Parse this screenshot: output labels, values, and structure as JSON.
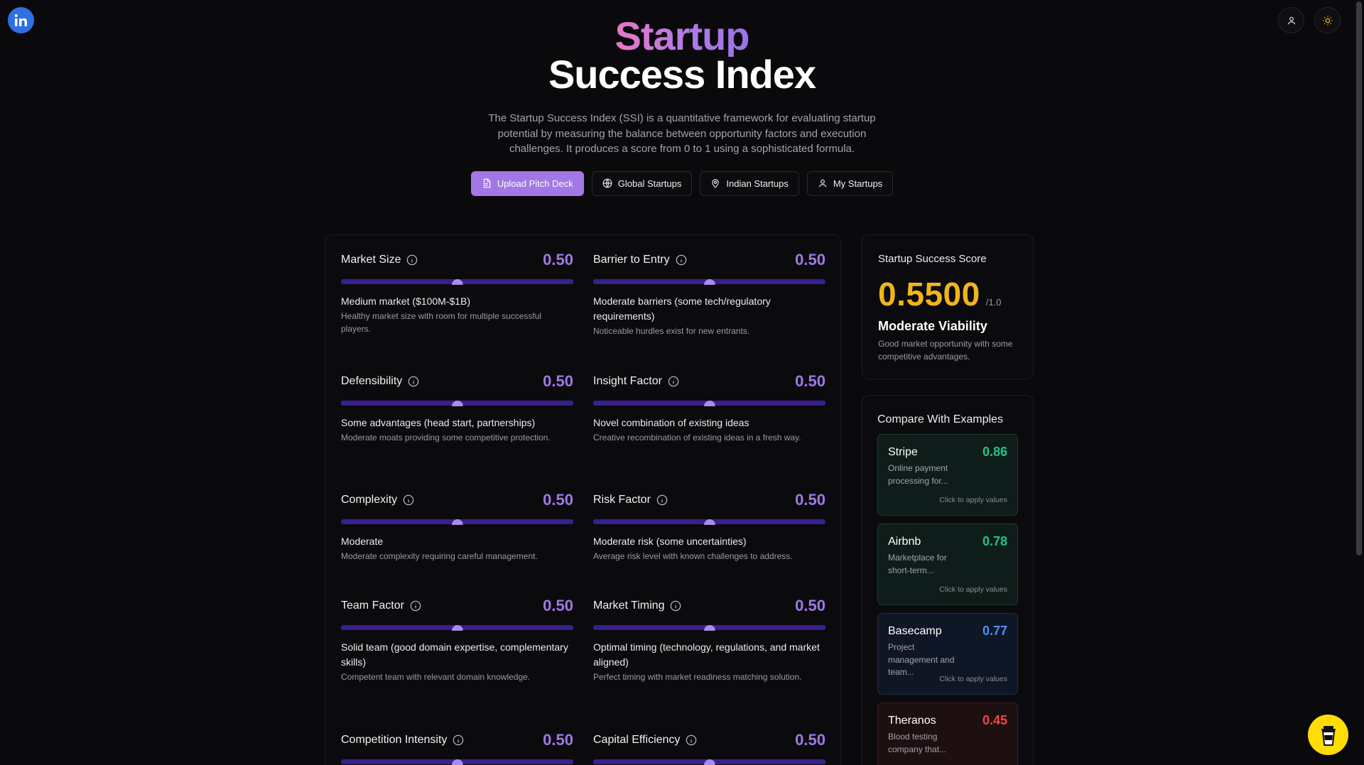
{
  "hero": {
    "title_line1": "Startup",
    "title_line2": "Success Index",
    "description": "The Startup Success Index (SSI) is a quantitative framework for evaluating startup potential by measuring the balance between opportunity factors and execution challenges. It produces a score from 0 to 1 using a sophisticated formula."
  },
  "actions": {
    "upload": "Upload Pitch Deck",
    "global": "Global Startups",
    "indian": "Indian Startups",
    "mine": "My Startups"
  },
  "factors": [
    {
      "name": "Market Size",
      "value": "0.50",
      "level": 0.5,
      "label": "Medium market ($100M-$1B)",
      "desc": "Healthy market size with room for multiple successful players."
    },
    {
      "name": "Barrier to Entry",
      "value": "0.50",
      "level": 0.5,
      "label": "Moderate barriers (some tech/regulatory requirements)",
      "desc": "Noticeable hurdles exist for new entrants."
    },
    {
      "name": "Defensibility",
      "value": "0.50",
      "level": 0.5,
      "label": "Some advantages (head start, partnerships)",
      "desc": "Moderate moats providing some competitive protection."
    },
    {
      "name": "Insight Factor",
      "value": "0.50",
      "level": 0.5,
      "label": "Novel combination of existing ideas",
      "desc": "Creative recombination of existing ideas in a fresh way."
    },
    {
      "name": "Complexity",
      "value": "0.50",
      "level": 0.5,
      "label": "Moderate",
      "desc": "Moderate complexity requiring careful management."
    },
    {
      "name": "Risk Factor",
      "value": "0.50",
      "level": 0.5,
      "label": "Moderate risk (some uncertainties)",
      "desc": "Average risk level with known challenges to address."
    },
    {
      "name": "Team Factor",
      "value": "0.50",
      "level": 0.5,
      "label": "Solid team (good domain expertise, complementary skills)",
      "desc": "Competent team with relevant domain knowledge."
    },
    {
      "name": "Market Timing",
      "value": "0.50",
      "level": 0.5,
      "label": "Optimal timing (technology, regulations, and market aligned)",
      "desc": "Perfect timing with market readiness matching solution."
    },
    {
      "name": "Competition Intensity",
      "value": "0.50",
      "level": 0.5,
      "label": "",
      "desc": ""
    },
    {
      "name": "Capital Efficiency",
      "value": "0.50",
      "level": 0.5,
      "label": "",
      "desc": ""
    }
  ],
  "score": {
    "title": "Startup Success Score",
    "value": "0.5500",
    "max": "/1.0",
    "verdict": "Moderate Viability",
    "verdict_desc": "Good market opportunity with some competitive advantages."
  },
  "compare": {
    "title": "Compare With Examples",
    "hint": "Click to apply values",
    "examples": [
      {
        "name": "Stripe",
        "score": "0.86",
        "desc": "Online payment processing for...",
        "color": "#22c48a",
        "tone": "green"
      },
      {
        "name": "Airbnb",
        "score": "0.78",
        "desc": "Marketplace for short-term...",
        "color": "#22c48a",
        "tone": "green"
      },
      {
        "name": "Basecamp",
        "score": "0.77",
        "desc": "Project management and team...",
        "color": "#4f8ff7",
        "tone": "blue"
      },
      {
        "name": "Theranos",
        "score": "0.45",
        "desc": "Blood testing company that...",
        "color": "#f04848",
        "tone": "red"
      }
    ]
  },
  "colors": {
    "accent": "#a277e6",
    "score": "#f0b51c",
    "background": "#0a0a0c"
  },
  "icons": {
    "logo": "linkedin-icon",
    "user": "user-icon",
    "theme": "sun-icon",
    "info": "info-icon",
    "cup": "coffee-cup-icon"
  }
}
